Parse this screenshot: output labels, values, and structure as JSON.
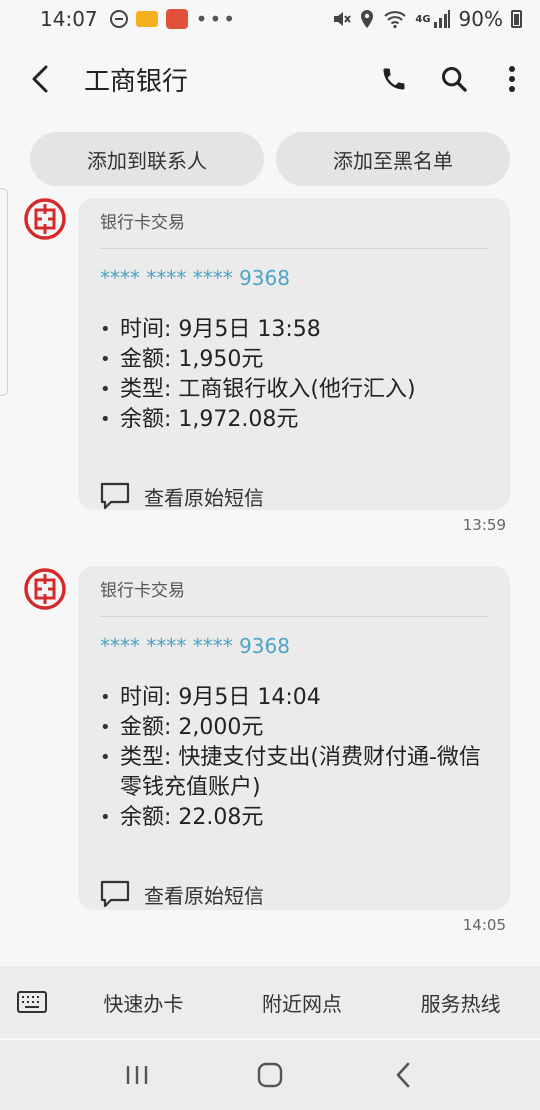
{
  "status_bar": {
    "time": "14:07",
    "network": "4G",
    "battery": "90%"
  },
  "header": {
    "title": "工商银行",
    "icons": [
      "back-arrow-icon",
      "phone-icon",
      "search-icon",
      "more-vert-icon"
    ]
  },
  "chips": {
    "add_contact": "添加到联系人",
    "add_blacklist": "添加至黑名单"
  },
  "messages": [
    {
      "title": "银行卡交易",
      "card": "**** **** **** 9368",
      "lines": [
        "时间: 9月5日 13:58",
        "金额: 1,950元",
        "类型: 工商银行收入(他行汇入)",
        "余额: 1,972.08元"
      ],
      "view_raw": "查看原始短信",
      "time": "13:59"
    },
    {
      "title": "银行卡交易",
      "card": "**** **** **** 9368",
      "lines": [
        "时间: 9月5日 14:04",
        "金额: 2,000元",
        "类型: 快捷支付支出(消费财付通-微信零钱充值账户)",
        "余额: 22.08元"
      ],
      "view_raw": "查看原始短信",
      "time": "14:05"
    }
  ],
  "quick_menu": {
    "items": [
      "快速办卡",
      "附近网点",
      "服务热线"
    ]
  },
  "colors": {
    "accent_link": "#4ea3c7",
    "bank_red": "#d32b2b",
    "bubble_bg": "#ebebeb"
  }
}
